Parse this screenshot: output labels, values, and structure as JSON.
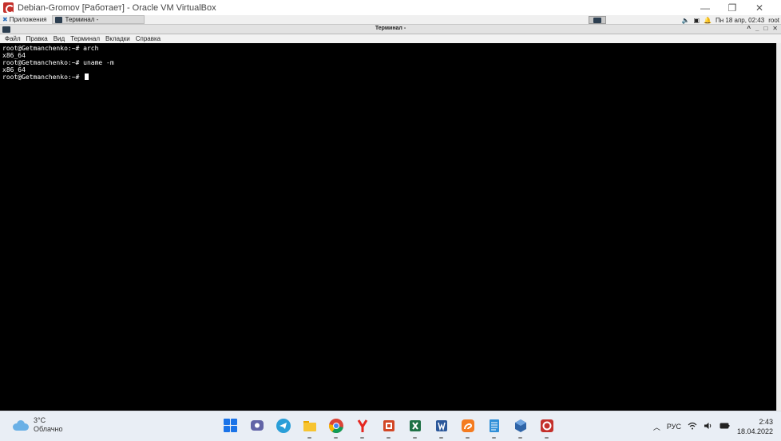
{
  "host_window": {
    "title": "Debian-Gromov [Работает] - Oracle VM VirtualBox",
    "minimize": "—",
    "restore": "❐",
    "close": "✕"
  },
  "guest_panel": {
    "apps_label": "Приложения",
    "task_label": "Терминал -",
    "datetime": "Пн 18 апр, 02:43",
    "user": "root"
  },
  "terminal": {
    "title": "Терминал -",
    "menu": [
      "Файл",
      "Правка",
      "Вид",
      "Терминал",
      "Вкладки",
      "Справка"
    ],
    "lines": [
      "root@Getmanchenko:~# arch",
      "x86_64",
      "root@Getmanchenko:~# uname -m",
      "x86_64",
      "root@Getmanchenko:~# "
    ]
  },
  "taskbar": {
    "weather": {
      "temp": "3°C",
      "condition": "Облачно"
    },
    "apps": [
      "start",
      "teams-chat",
      "telegram",
      "file-explorer",
      "chrome",
      "yandex-browser",
      "powerpoint",
      "excel",
      "word",
      "squirrel",
      "notepad",
      "virtualbox",
      "debian"
    ],
    "tray": {
      "language": "РУС",
      "time": "2:43",
      "date": "18.04.2022"
    }
  }
}
